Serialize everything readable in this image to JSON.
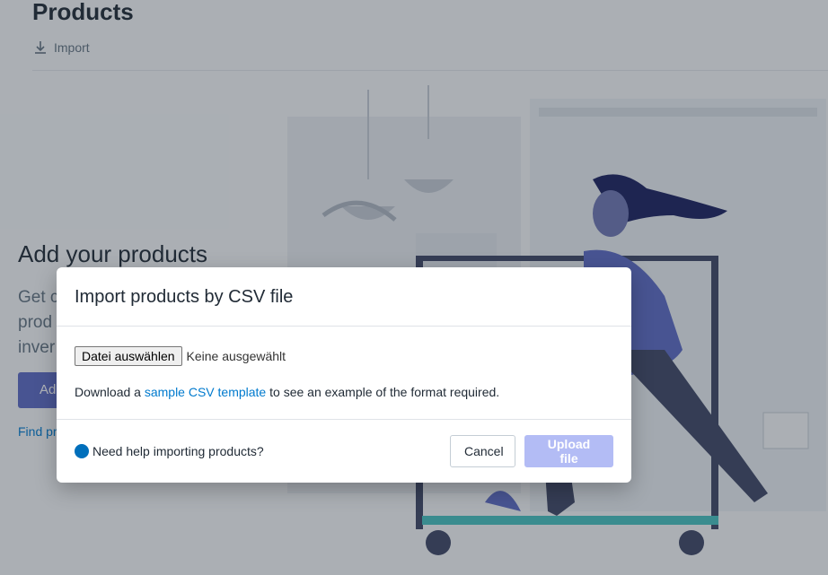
{
  "page": {
    "title": "Products",
    "import_label": "Import"
  },
  "hero": {
    "heading": "Add your products",
    "body": "Get c prod inver",
    "add_button": "Ad",
    "link": "Find pr"
  },
  "modal": {
    "title": "Import products by CSV file",
    "file_button": "Datei auswählen",
    "file_status": "Keine ausgewählt",
    "download_prefix": "Download a ",
    "download_link": "sample CSV template",
    "download_suffix": " to see an example of the format required.",
    "help_text": "Need help importing products?",
    "cancel_label": "Cancel",
    "upload_label": "Upload file"
  },
  "icons": {
    "import": "download-icon",
    "help": "help-circle-icon"
  },
  "colors": {
    "link": "#007ace",
    "primary_disabled": "#b3bcf5",
    "help_dot": "#006fbb"
  }
}
